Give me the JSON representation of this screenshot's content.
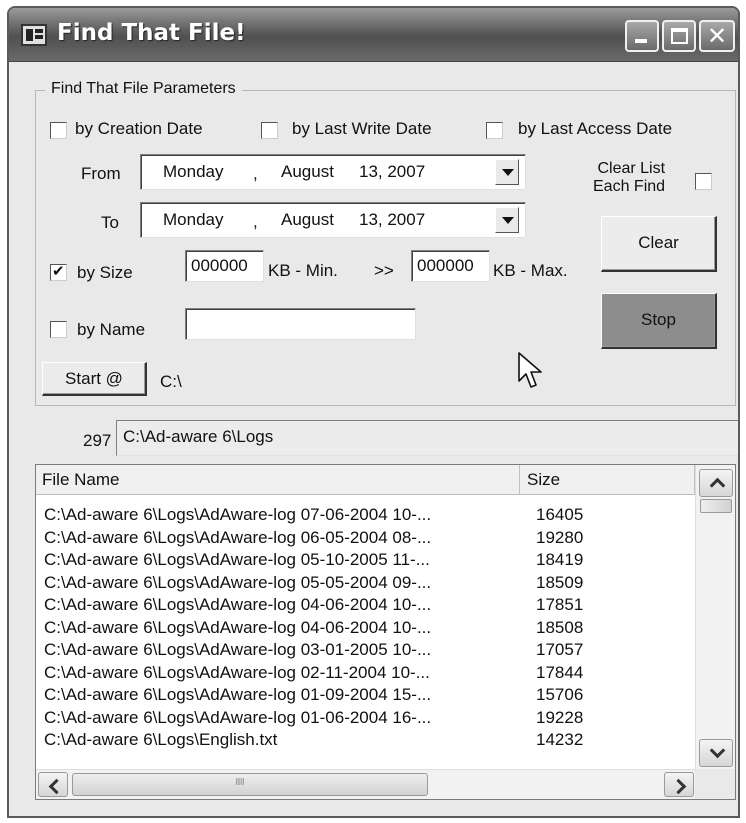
{
  "window": {
    "title": "Find That File!"
  },
  "params": {
    "group_label": "Find That File Parameters",
    "by_creation_date": {
      "label": "by Creation Date",
      "checked": false
    },
    "by_last_write_date": {
      "label": "by Last Write Date",
      "checked": false
    },
    "by_last_access_date": {
      "label": "by Last Access Date",
      "checked": false
    },
    "from": {
      "label": "From",
      "weekday": "Monday",
      "sep": ",",
      "month_day": "August",
      "day_year": "13, 2007"
    },
    "to": {
      "label": "To",
      "weekday": "Monday",
      "sep": ",",
      "month_day": "August",
      "day_year": "13, 2007"
    },
    "clear_list": {
      "label_line1": "Clear List",
      "label_line2": "Each Find",
      "checked": false
    },
    "by_size": {
      "label": "by Size",
      "checked": true,
      "min_value": "000000",
      "min_unit": "KB - Min.",
      "arrow": ">>",
      "max_value": "000000",
      "max_unit": "KB - Max."
    },
    "by_name": {
      "label": "by Name",
      "checked": false,
      "value": ""
    },
    "start": {
      "button": "Start @",
      "path": "C:\\"
    },
    "clear_button": "Clear",
    "stop_button": "Stop"
  },
  "status": {
    "count": "297",
    "current_path": "C:\\Ad-aware 6\\Logs"
  },
  "results": {
    "columns": [
      "File Name",
      "Size"
    ],
    "rows": [
      {
        "name": "C:\\Ad-aware 6\\Logs\\AdAware-log 07-06-2004 10-...",
        "size": "16405"
      },
      {
        "name": "C:\\Ad-aware 6\\Logs\\AdAware-log 06-05-2004 08-...",
        "size": "19280"
      },
      {
        "name": "C:\\Ad-aware 6\\Logs\\AdAware-log 05-10-2005 11-...",
        "size": "18419"
      },
      {
        "name": "C:\\Ad-aware 6\\Logs\\AdAware-log 05-05-2004 09-...",
        "size": "18509"
      },
      {
        "name": "C:\\Ad-aware 6\\Logs\\AdAware-log 04-06-2004 10-...",
        "size": "17851"
      },
      {
        "name": "C:\\Ad-aware 6\\Logs\\AdAware-log 04-06-2004 10-...",
        "size": "18508"
      },
      {
        "name": "C:\\Ad-aware 6\\Logs\\AdAware-log 03-01-2005 10-...",
        "size": "17057"
      },
      {
        "name": "C:\\Ad-aware 6\\Logs\\AdAware-log 02-11-2004 10-...",
        "size": "17844"
      },
      {
        "name": "C:\\Ad-aware 6\\Logs\\AdAware-log 01-09-2004 15-...",
        "size": "15706"
      },
      {
        "name": "C:\\Ad-aware 6\\Logs\\AdAware-log 01-06-2004 16-...",
        "size": "19228"
      },
      {
        "name": "C:\\Ad-aware 6\\Logs\\English.txt",
        "size": "14232"
      }
    ]
  },
  "icons": {
    "app": "app-icon",
    "minimize": "minimize-icon",
    "maximize": "maximize-icon",
    "close": "close-icon",
    "cursor": "mouse-pointer-icon",
    "dropdown": "chevron-down-icon"
  }
}
